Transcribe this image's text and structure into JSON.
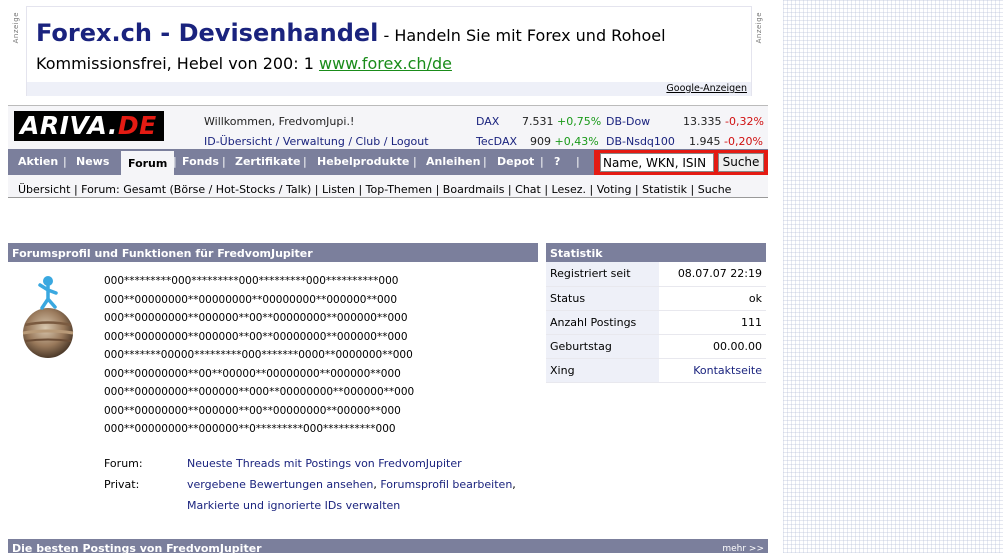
{
  "ad": {
    "side_label": "Anzeige",
    "title": "Forex.ch - Devisenhandel",
    "tagline": " - Handeln Sie mit Forex und Rohoel",
    "line2": "Kommissionsfrei, Hebel von 200: 1 ",
    "url": "www.forex.ch/de",
    "footer_link": "Google-Anzeigen"
  },
  "header": {
    "logo_main": "ARIVA.",
    "logo_accent": "DE",
    "welcome": "Willkommen, FredvomJupi.!",
    "account_links": "ID-Übersicht / Verwaltung / Club / Logout"
  },
  "tickers": [
    {
      "name": "DAX",
      "value": "7.531",
      "change": "+0,75%",
      "dir": "pos"
    },
    {
      "name": "DB-Dow",
      "value": "13.335",
      "change": "-0,32%",
      "dir": "neg"
    },
    {
      "name": "TecDAX",
      "value": "909",
      "change": "+0,43%",
      "dir": "pos"
    },
    {
      "name": "DB-Nsdq100",
      "value": "1.945",
      "change": "-0,20%",
      "dir": "neg"
    }
  ],
  "nav": {
    "items": [
      "Aktien",
      "News",
      "Forum",
      "Fonds",
      "Zertifikate",
      "Hebelprodukte",
      "Anleihen",
      "Depot",
      "?"
    ],
    "active": "Forum",
    "separator": "|",
    "search_placeholder": "Name, WKN, ISIN",
    "search_button": "Suche"
  },
  "subnav": "Übersicht | Forum: Gesamt (Börse / Hot-Stocks / Talk) | Listen | Top-Themen | Boardmails | Chat | Lesez. | Voting | Statistik | Suche",
  "profile": {
    "heading": "Forumsprofil und Funktionen für FredvomJupiter",
    "signature": [
      "000*********000*********000*********000**********000",
      "000**00000000**00000000**00000000**000000**000",
      "000**00000000**000000**00**00000000**000000**000",
      "000**00000000**000000**00**00000000**000000**000",
      "000*******00000*********000*******0000**0000000**000",
      "000**00000000**00**00000**00000000**000000**000",
      "000**00000000**000000**000**00000000**000000**000",
      "000**00000000**000000**00**00000000**00000**000",
      "000**00000000**000000**0*********000**********000"
    ],
    "forum_label": "Forum:",
    "forum_link": "Neueste Threads mit Postings von FredvomJupiter",
    "private_label": "Privat:",
    "private_link1": "vergebene Bewertungen ansehen",
    "private_sep1": ", ",
    "private_link2": "Forumsprofil bearbeiten",
    "private_sep2": ",",
    "private_link3": "Markierte und ignorierte IDs verwalten"
  },
  "stats": {
    "heading": "Statistik",
    "rows": [
      {
        "label": "Registriert seit",
        "value": "08.07.07 22:19"
      },
      {
        "label": "Status",
        "value": "ok"
      },
      {
        "label": "Anzahl Postings",
        "value": "111"
      },
      {
        "label": "Geburtstag",
        "value": "00.00.00"
      },
      {
        "label": "Xing",
        "value": "Kontaktseite"
      }
    ]
  },
  "bottom": {
    "heading": "Die besten Postings von FredvomJupiter",
    "more": "mehr >>"
  },
  "colors": {
    "nav_bg": "#7b7f9c",
    "brand_red": "#e41b13",
    "link_blue": "#1a237e",
    "positive": "#1a9a1a",
    "negative": "#d01010"
  }
}
